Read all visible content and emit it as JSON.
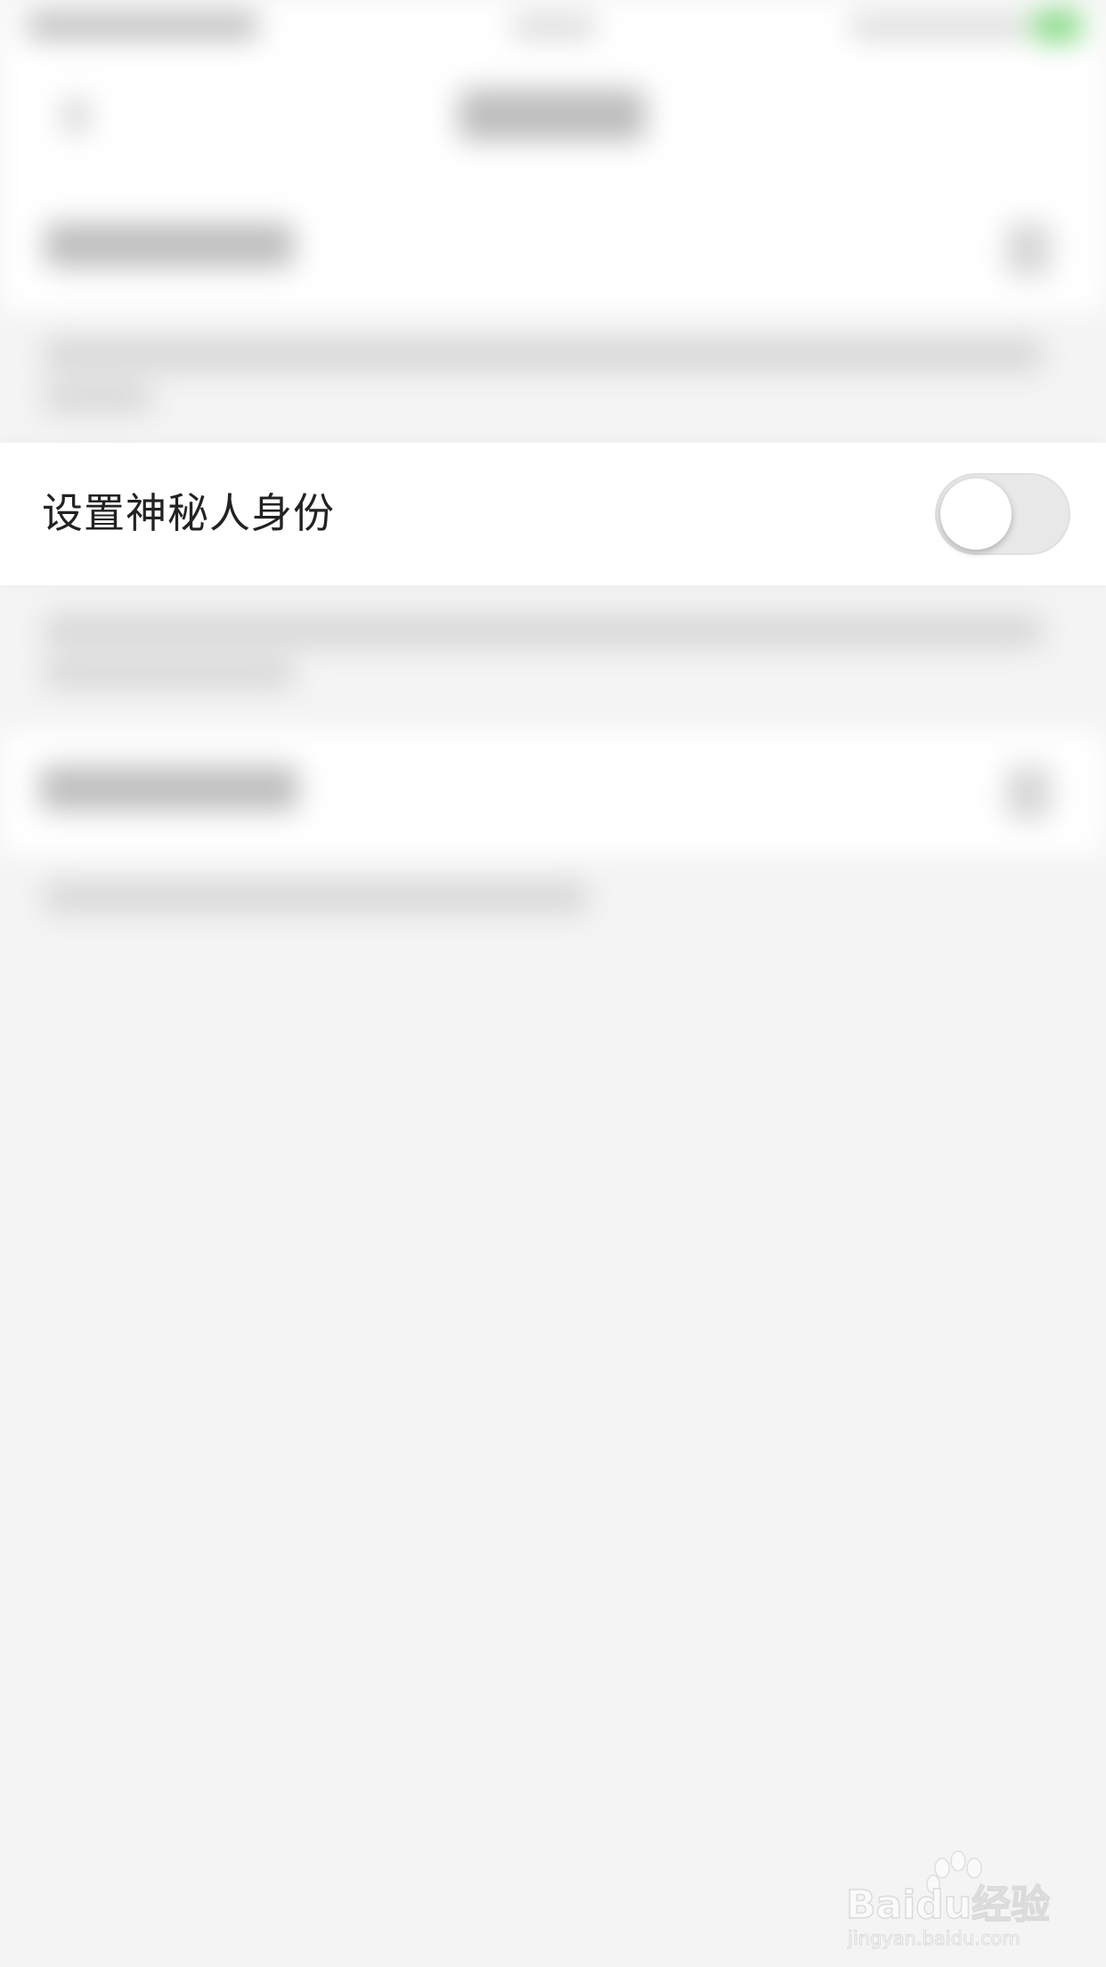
{
  "settings": {
    "mystery_identity_label": "设置神秘人身份",
    "mystery_identity_enabled": false
  },
  "colors": {
    "background": "#f4f4f4",
    "row_background": "#ffffff",
    "toggle_off": "#e8e8e8",
    "text_primary": "#222222"
  },
  "watermark": {
    "brand": "Baidu经验",
    "domain": "jingyan.baidu.com"
  }
}
